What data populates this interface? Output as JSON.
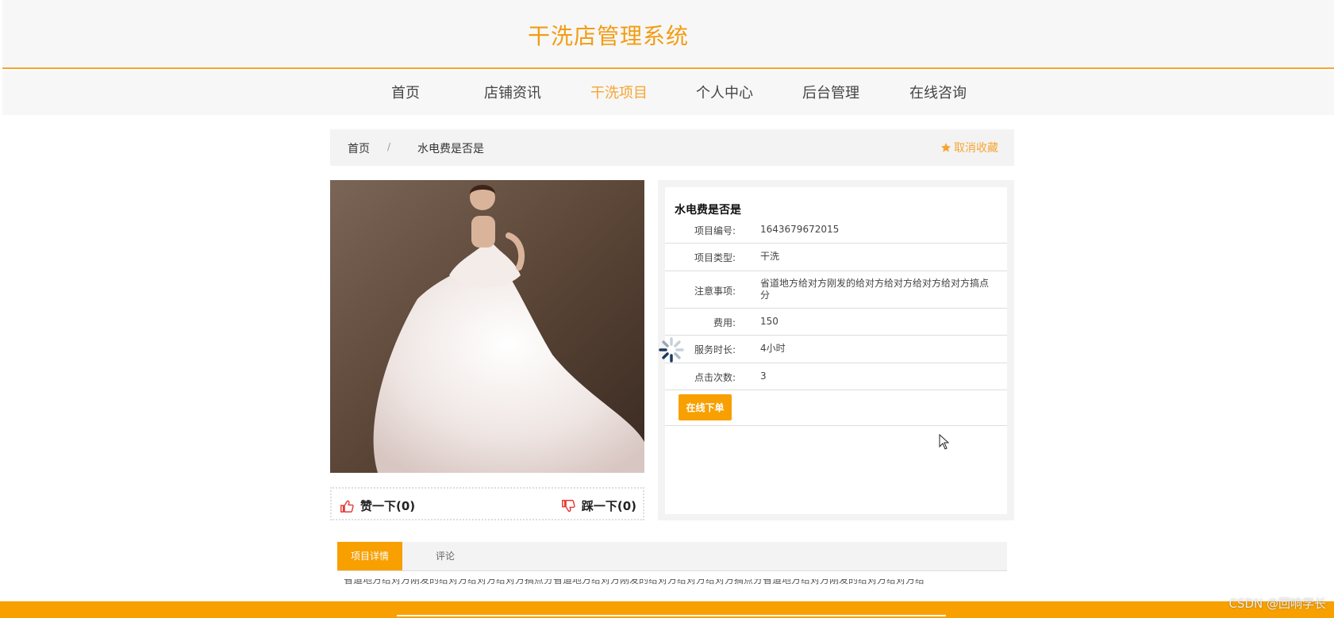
{
  "header": {
    "title": "干洗店管理系统"
  },
  "nav": {
    "items": [
      {
        "label": "首页"
      },
      {
        "label": "店铺资讯"
      },
      {
        "label": "干洗项目",
        "active": true
      },
      {
        "label": "个人中心"
      },
      {
        "label": "后台管理"
      },
      {
        "label": "在线咨询"
      }
    ]
  },
  "breadcrumb": {
    "home": "首页",
    "separator": "/",
    "current": "水电费是否是",
    "favorite_label": "取消收藏"
  },
  "product": {
    "title": "水电费是否是",
    "fields": [
      {
        "label": "项目编号:",
        "value": "1643679672015"
      },
      {
        "label": "项目类型:",
        "value": "干洗"
      },
      {
        "label": "注意事项:",
        "value": "省道地方给对方刚发的给对方给对方给对方给对方搞点分"
      },
      {
        "label": "费用:",
        "value": "150"
      },
      {
        "label": "服务时长:",
        "value": "4小时"
      },
      {
        "label": "点击次数:",
        "value": "3"
      }
    ],
    "order_button": "在线下单"
  },
  "votes": {
    "like": "赞一下(0)",
    "dislike": "踩一下(0)"
  },
  "tabs": {
    "detail": "项目详情",
    "comments": "评论",
    "detail_text": "省道地方给对方刚发的给对方给对方给对方搞点分省道地方给对方刚发的给对方给对方给对方搞点分省道地方给对方刚发的给对方给对方给"
  },
  "watermark": "CSDN @回响学长",
  "colors": {
    "accent": "#f7a000",
    "title": "#f39c12",
    "nav_active": "#f7a531"
  },
  "icons": [
    "star-icon",
    "thumbs-up-icon",
    "thumbs-down-icon",
    "loading-spinner-icon",
    "mouse-cursor-icon"
  ]
}
